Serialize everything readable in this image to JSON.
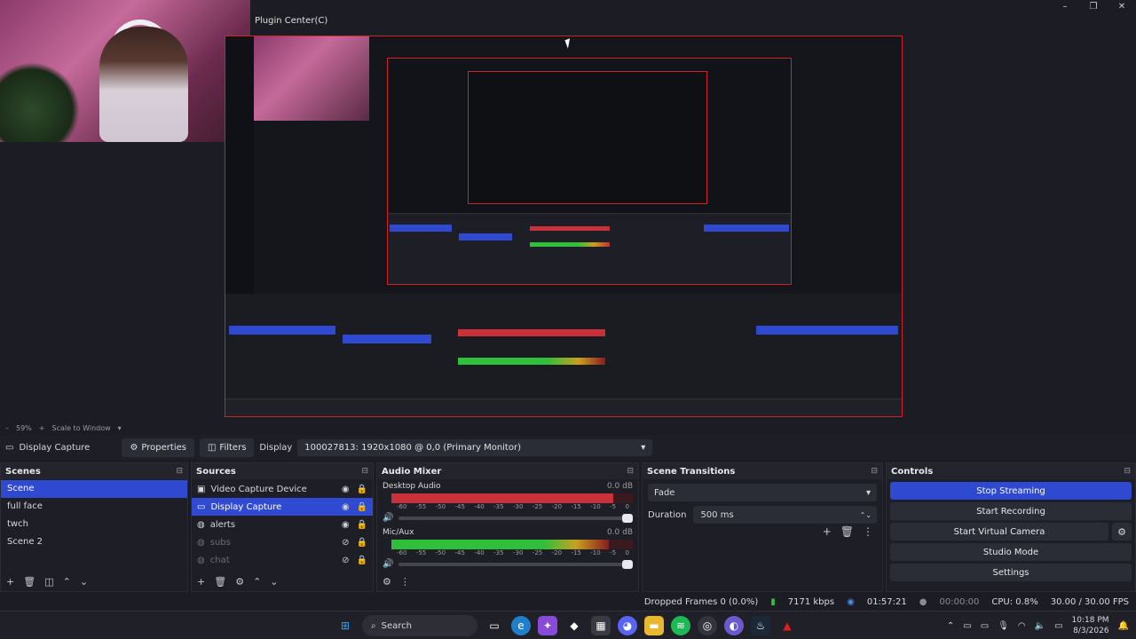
{
  "preview": {
    "window_title": "Plugin Center(C)",
    "window_controls": [
      "–",
      "❐",
      "✕"
    ]
  },
  "zoom": {
    "minus": "–",
    "level": "59%",
    "plus": "+",
    "mode": "Scale to Window",
    "arrow": "▾"
  },
  "source_bar": {
    "source_name": "Display Capture",
    "properties_label": "Properties",
    "filters_label": "Filters",
    "display_label": "Display",
    "display_value": "100027813: 1920x1080 @ 0,0 (Primary Monitor)"
  },
  "scenes": {
    "title": "Scenes",
    "items": [
      "Scene",
      "full face",
      "twch",
      "Scene 2"
    ],
    "selected_index": 0
  },
  "sources": {
    "title": "Sources",
    "items": [
      {
        "name": "Video Capture Device",
        "icon": "camera-icon",
        "visible": true,
        "locked": true,
        "selected": false,
        "dim": false
      },
      {
        "name": "Display Capture",
        "icon": "monitor-icon",
        "visible": true,
        "locked": true,
        "selected": true,
        "dim": false
      },
      {
        "name": "alerts",
        "icon": "browser-icon",
        "visible": true,
        "locked": true,
        "selected": false,
        "dim": false
      },
      {
        "name": "subs",
        "icon": "browser-icon",
        "visible": false,
        "locked": true,
        "selected": false,
        "dim": true
      },
      {
        "name": "chat",
        "icon": "browser-icon",
        "visible": false,
        "locked": true,
        "selected": false,
        "dim": true
      }
    ]
  },
  "mixer": {
    "title": "Audio Mixer",
    "channels": [
      {
        "name": "Desktop Audio",
        "db": "0.0 dB",
        "level": 0.92,
        "peak": 0.72,
        "color": "#c8303a"
      },
      {
        "name": "Mic/Aux",
        "db": "0.0 dB",
        "level": 0.9,
        "peak": 0.79,
        "color": "#2fbf3a"
      }
    ],
    "scale": [
      "-60",
      "-55",
      "-50",
      "-45",
      "-40",
      "-35",
      "-30",
      "-25",
      "-20",
      "-15",
      "-10",
      "-5",
      "0"
    ]
  },
  "transitions": {
    "title": "Scene Transitions",
    "selected": "Fade",
    "duration_label": "Duration",
    "duration_value": "500 ms"
  },
  "controls": {
    "title": "Controls",
    "stop_streaming": "Stop Streaming",
    "start_recording": "Start Recording",
    "start_virtual_camera": "Start Virtual Camera",
    "studio_mode": "Studio Mode",
    "settings": "Settings"
  },
  "status": {
    "dropped_frames": "Dropped Frames 0 (0.0%)",
    "bitrate": "7171 kbps",
    "stream_time": "01:57:21",
    "rec_time": "00:00:00",
    "cpu": "CPU: 0.8%",
    "fps": "30.00 / 30.00 FPS"
  },
  "taskbar": {
    "search_label": "Search",
    "time": "10:18 PM",
    "date": "8/3/2026"
  },
  "colors": {
    "accent": "#2f4ad0",
    "bg": "#1c1d24",
    "panel": "#1e1f26",
    "frame": "#d0202a"
  }
}
